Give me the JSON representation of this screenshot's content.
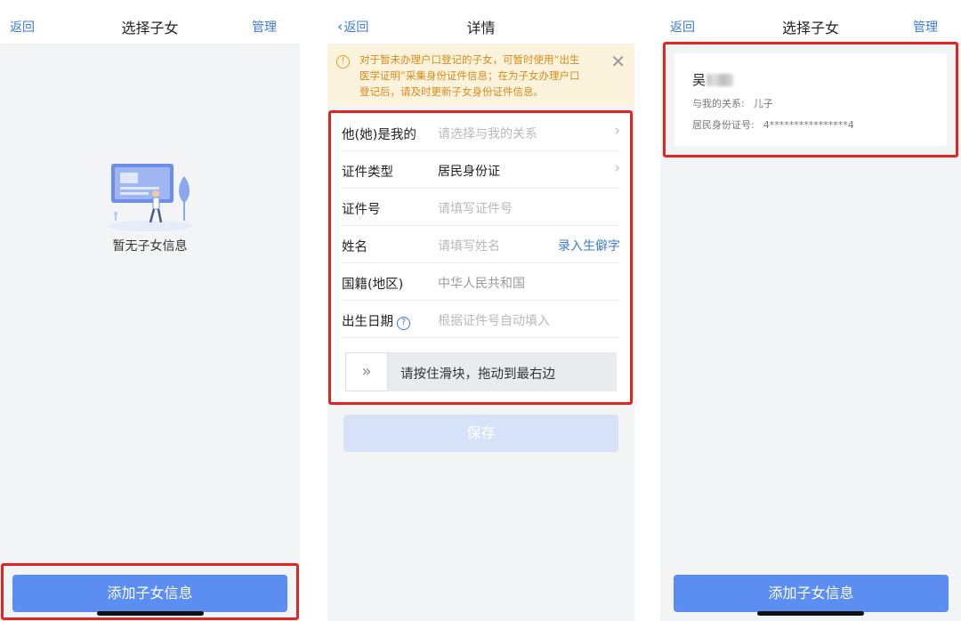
{
  "screen1": {
    "nav": {
      "back": "返回",
      "title": "选择子女",
      "right": "管理"
    },
    "empty_text": "暂无子女信息",
    "add_button": "添加子女信息"
  },
  "screen2": {
    "nav": {
      "back": "返回",
      "title": "详情"
    },
    "notice": {
      "icon": "info-icon",
      "line1": "对于暂未办理户口登记的子女，可暂时使用“出生",
      "line2": "医学证明”采集身份证件信息；在为子女办理户口",
      "line3": "登记后，请及时更新子女身份证件信息。"
    },
    "form": {
      "relation": {
        "label": "他(她)是我的",
        "placeholder": "请选择与我的关系"
      },
      "id_type": {
        "label": "证件类型",
        "value": "居民身份证"
      },
      "id_number": {
        "label": "证件号",
        "placeholder": "请填写证件号"
      },
      "name": {
        "label": "姓名",
        "placeholder": "请填写姓名",
        "link": "录入生僻字"
      },
      "nationality": {
        "label": "国籍(地区)",
        "value": "中华人民共和国"
      },
      "birth_date": {
        "label": "出生日期",
        "placeholder": "根据证件号自动填入"
      }
    },
    "slider": {
      "handle": "»",
      "text": "请按住滑块，拖动到最右边"
    },
    "save_button": "保存"
  },
  "screen3": {
    "nav": {
      "back": "返回",
      "title": "选择子女",
      "right": "管理"
    },
    "child": {
      "surname": "吴",
      "relation_label": "与我的关系:",
      "relation_value": "儿子",
      "id_label": "居民身份证号:",
      "id_value": "4****************4"
    },
    "add_button": "添加子女信息"
  },
  "colors": {
    "accent": "#3d7bd8",
    "button": "#5b8ef0",
    "highlight_box": "#e42420",
    "notice_bg": "#fbf3dc",
    "notice_text": "#d88a1c"
  }
}
